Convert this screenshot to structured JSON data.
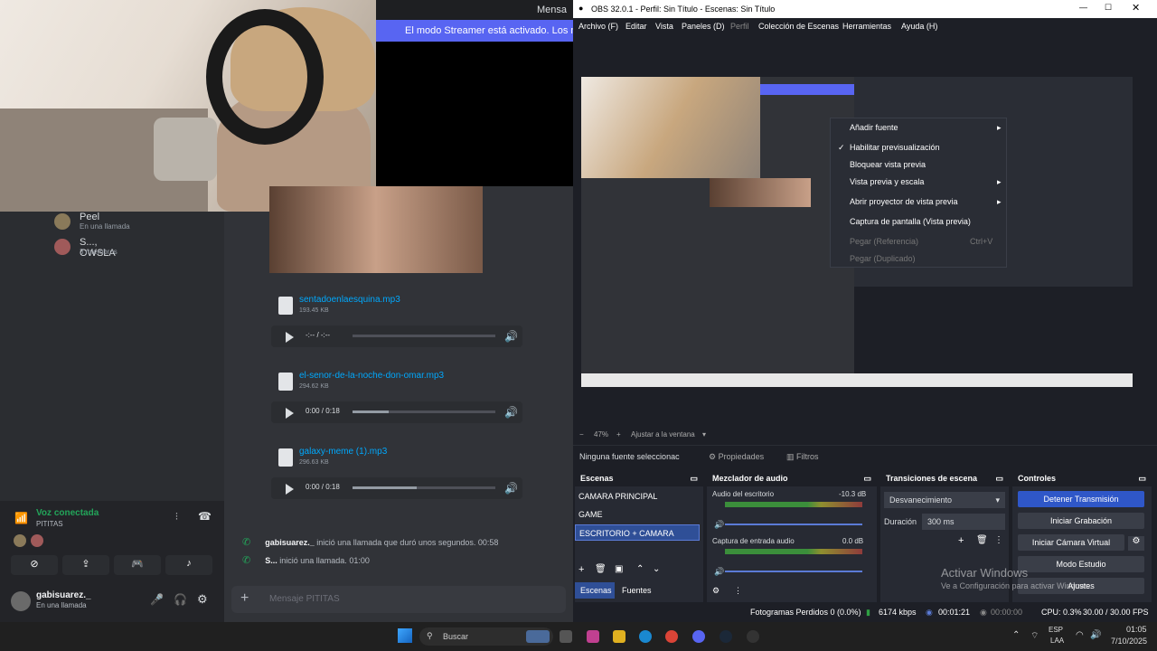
{
  "discord": {
    "topbar_title": "Mensa",
    "streamer_banner": "El modo Streamer está activado. Los nombres",
    "dms": [
      {
        "name": "Peel",
        "sub": "En una llamada"
      },
      {
        "name": "S..., OWSLA",
        "sub": "3 miembros"
      }
    ],
    "attachments": [
      {
        "name": "sentadoenlaesquina.mp3",
        "size": "193.45 KB",
        "time": "-:-- / -:--",
        "progress": 0
      },
      {
        "name": "el-senor-de-la-noche-don-omar.mp3",
        "size": "294.62 KB",
        "time": "0:00 / 0:18",
        "progress": 0.25
      },
      {
        "name": "galaxy-meme (1).mp3",
        "size": "296.63 KB",
        "time": "0:00 / 0:18",
        "progress": 0.45
      }
    ],
    "voice": {
      "status": "Voz conectada",
      "channel": "PITITAS"
    },
    "user": {
      "name": "gabisuarez._",
      "status": "En una llamada"
    },
    "messages": [
      {
        "user": "gabisuarez._",
        "text": "inició una llamada que duró unos segundos.",
        "time": "00:58"
      },
      {
        "user": "S...",
        "text": "inició una llamada.",
        "time": "01:00"
      }
    ],
    "composer_placeholder": "Mensaje PITITAS"
  },
  "obs": {
    "title": "OBS 32.0.1 - Perfil: Sin Título - Escenas: Sin Título",
    "menu": [
      "Archivo (F)",
      "Editar",
      "Vista",
      "Paneles (D)",
      "Perfil",
      "Colección de Escenas",
      "Herramientas",
      "Ayuda (H)"
    ],
    "context_menu": {
      "items": [
        "Añadir fuente",
        "Habilitar previsualización",
        "Bloquear vista previa",
        "Vista previa y escala",
        "Abrir proyector de vista previa",
        "Captura de pantalla (Vista previa)",
        "Pegar (Referencia)",
        "Pegar (Duplicado)"
      ],
      "shortcut": "Ctrl+V"
    },
    "zoom": "47%",
    "fit_label": "Ajustar a la ventana",
    "no_source": "Ninguna fuente seleccionac",
    "properties": "Propiedades",
    "filters": "Filtros",
    "docks": {
      "scenes": {
        "title": "Escenas",
        "items": [
          "CAMARA PRINCIPAL",
          "GAME",
          "ESCRITORIO + CAMARA"
        ],
        "tab1": "Escenas",
        "tab2": "Fuentes"
      },
      "mixer": {
        "title": "Mezclador de audio",
        "channels": [
          {
            "name": "Audio del escritorio",
            "db": "-10.3 dB"
          },
          {
            "name": "Captura de entrada audio",
            "db": "0.0 dB"
          }
        ]
      },
      "transitions": {
        "title": "Transiciones de escena",
        "type": "Desvanecimiento",
        "duration_label": "Duración",
        "duration": "300 ms"
      },
      "controls": {
        "title": "Controles",
        "buttons": [
          "Detener Transmisión",
          "Iniciar Grabación",
          "Iniciar Cámara Virtual",
          "Modo Estudio",
          "Ajustes"
        ]
      }
    },
    "watermark": {
      "line1": "Activar Windows",
      "line2": "Ve a Configuración para activar Windows."
    },
    "status": {
      "dropped": "Fotogramas Perdidos 0 (0.0%)",
      "kbps": "6174 kbps",
      "live": "00:01:21",
      "rec": "00:00:00",
      "cpu": "CPU: 0.3%",
      "fps": "30.00 / 30.00 FPS"
    }
  },
  "taskbar": {
    "search": "Buscar",
    "lang": "ESP",
    "lang2": "LAA",
    "time": "01:05",
    "date": "7/10/2025"
  }
}
